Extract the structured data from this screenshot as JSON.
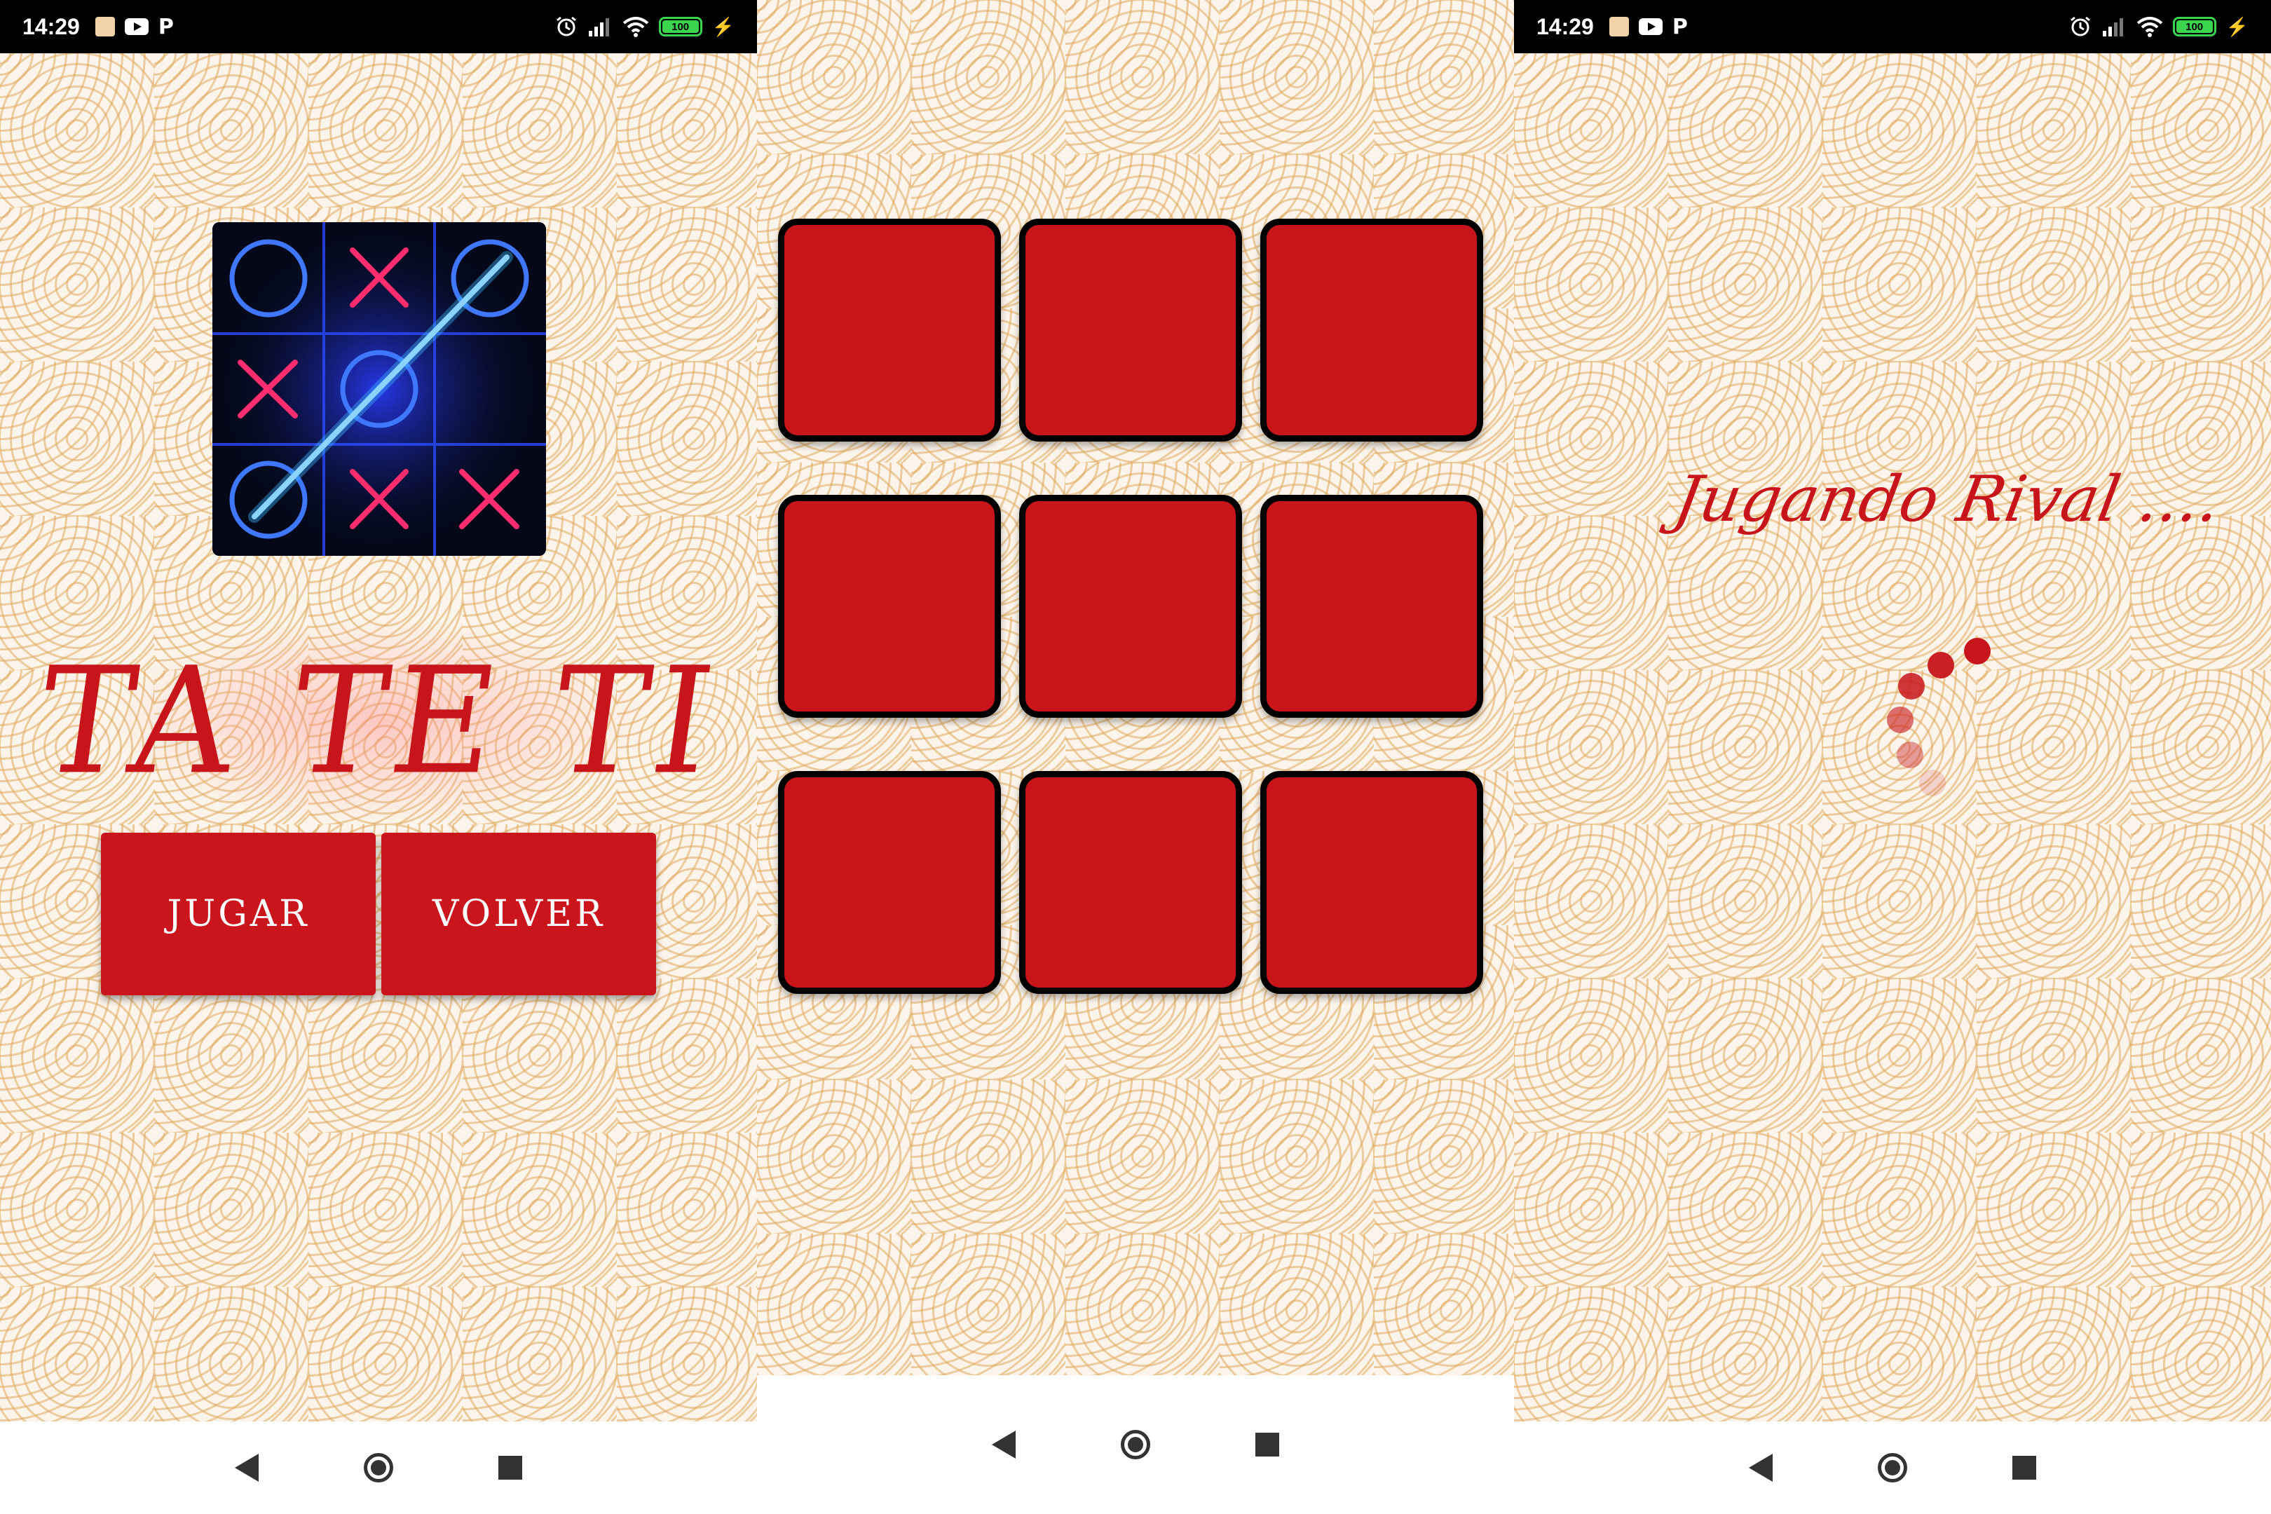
{
  "status_bar": {
    "time": "14:29",
    "battery": "100",
    "icons": [
      "notification-app-icon",
      "youtube-icon",
      "p-app-icon",
      "alarm-icon",
      "signal-icon",
      "wifi-icon",
      "battery-icon",
      "charging-icon"
    ]
  },
  "menu": {
    "title": "TA TE TI",
    "play_label": "JUGAR",
    "back_label": "VOLVER",
    "logo_board": [
      [
        "O",
        "X",
        "O"
      ],
      [
        "X",
        "O",
        ""
      ],
      [
        "O",
        "X",
        "X"
      ]
    ]
  },
  "board": {
    "cells": [
      "",
      "",
      "",
      "",
      "",
      "",
      "",
      "",
      ""
    ]
  },
  "waiting": {
    "message": "Jugando Rival ...."
  },
  "navbar": {
    "icons": [
      "back-icon",
      "home-icon",
      "recents-icon"
    ]
  },
  "colors": {
    "accent_red": "#c8151b",
    "wave_pattern": "#e0aa5f",
    "background": "#fbf4ea",
    "status_bar": "#000000",
    "battery_green": "#3bd44f"
  }
}
